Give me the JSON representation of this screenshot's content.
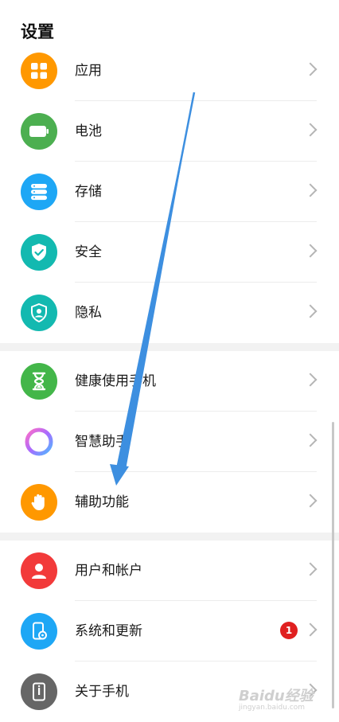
{
  "page_title": "设置",
  "group1": [
    {
      "label": "应用",
      "icon": "apps-icon",
      "color": "#FF9800"
    },
    {
      "label": "电池",
      "icon": "battery-icon",
      "color": "#4CAF50"
    },
    {
      "label": "存储",
      "icon": "storage-icon",
      "color": "#1EA7F5"
    },
    {
      "label": "安全",
      "icon": "shield-check-icon",
      "color": "#13B9B0"
    },
    {
      "label": "隐私",
      "icon": "privacy-shield-icon",
      "color": "#13B9B0"
    }
  ],
  "group2": [
    {
      "label": "健康使用手机",
      "icon": "hourglass-icon",
      "color": "#43B649"
    },
    {
      "label": "智慧助手",
      "icon": "assistant-ring-icon",
      "color": "#ffffff"
    },
    {
      "label": "辅助功能",
      "icon": "hand-icon",
      "color": "#FF9800"
    }
  ],
  "group3": [
    {
      "label": "用户和帐户",
      "icon": "user-icon",
      "color": "#F23A3A"
    },
    {
      "label": "系统和更新",
      "icon": "phone-settings-icon",
      "color": "#1EA7F5",
      "badge": "1"
    },
    {
      "label": "关于手机",
      "icon": "phone-info-icon",
      "color": "#666666"
    }
  ],
  "watermark": {
    "text": "Baidu经验",
    "sub": "jingyan.baidu.com"
  }
}
